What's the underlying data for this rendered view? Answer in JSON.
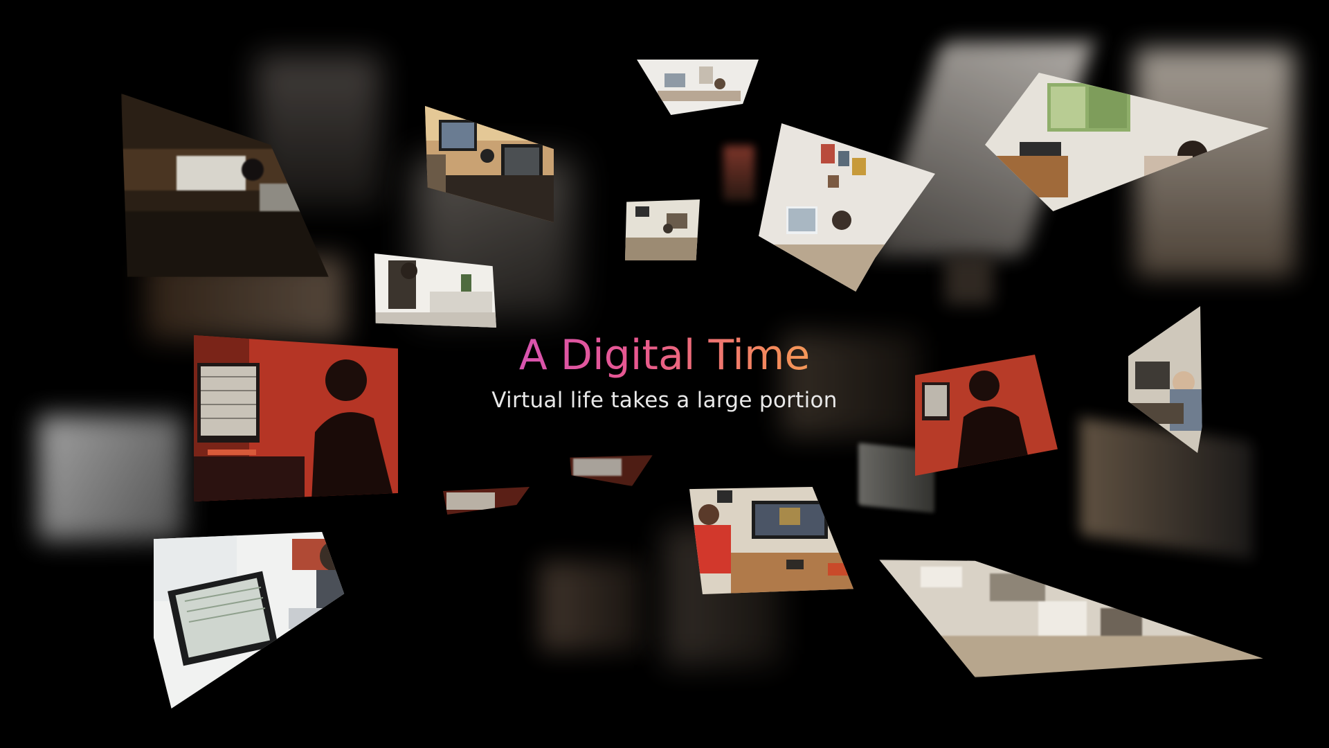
{
  "slide": {
    "title": "A Digital Time",
    "subtitle": "Virtual life takes a large portion",
    "title_gradient": [
      "#c54fd4",
      "#e8588f",
      "#f48a5a",
      "#f4d35a"
    ],
    "background": "#000000"
  },
  "photos": [
    {
      "name": "photo-dark-office-monitor"
    },
    {
      "name": "photo-desk-two-monitors"
    },
    {
      "name": "photo-white-desk-top"
    },
    {
      "name": "photo-small-desk-room"
    },
    {
      "name": "photo-person-desk-plant"
    },
    {
      "name": "photo-bright-studio-wall"
    },
    {
      "name": "photo-window-desk-man"
    },
    {
      "name": "photo-red-room-silhouette"
    },
    {
      "name": "photo-right-red-silhouette"
    },
    {
      "name": "photo-right-desk-person"
    },
    {
      "name": "photo-man-spreadsheet"
    },
    {
      "name": "photo-man-red-shirt-editing"
    },
    {
      "name": "photo-bottom-right-room"
    }
  ]
}
